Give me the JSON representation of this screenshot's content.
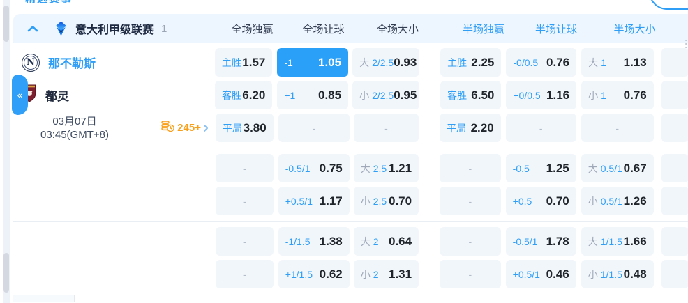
{
  "misc": {
    "dash": "-",
    "collapse_glyph": "«"
  },
  "top": {
    "clipped_tab": "精选赛事"
  },
  "league": {
    "title": "意大利甲级联赛",
    "count": "1",
    "columns": [
      {
        "label": "全场独赢",
        "scope": "full"
      },
      {
        "label": "全场让球",
        "scope": "full"
      },
      {
        "label": "全场大小",
        "scope": "full"
      },
      {
        "label": "半场独赢",
        "scope": "half"
      },
      {
        "label": "半场让球",
        "scope": "half"
      },
      {
        "label": "半场大小",
        "scope": "half"
      }
    ]
  },
  "match": {
    "home": "那不勒斯",
    "home_badge_letter": "N",
    "away": "都灵",
    "date": "03月07日",
    "time": "03:45(GMT+8)",
    "markets_count": "245+"
  },
  "colors": {
    "accent_blue": "#2f9ef6",
    "selected_bg": "#2aa0f8",
    "orange": "#f9a01b"
  },
  "odds": {
    "g1": {
      "rows": [
        {
          "cells": [
            {
              "label": "主胜",
              "value": "1.57"
            },
            {
              "line": "-1",
              "value": "1.05",
              "selected": true
            },
            {
              "prefix": "大",
              "line": "2/2.5",
              "value": "0.93"
            },
            {
              "label": "主胜",
              "value": "2.25"
            },
            {
              "line": "-0/0.5",
              "value": "0.76"
            },
            {
              "prefix": "大",
              "line": "1",
              "value": "1.13"
            }
          ]
        },
        {
          "cells": [
            {
              "label": "客胜",
              "value": "6.20"
            },
            {
              "line": "+1",
              "value": "0.85"
            },
            {
              "prefix": "小",
              "line": "2/2.5",
              "value": "0.95"
            },
            {
              "label": "客胜",
              "value": "6.50"
            },
            {
              "line": "+0/0.5",
              "value": "1.16"
            },
            {
              "prefix": "小",
              "line": "1",
              "value": "0.76"
            }
          ]
        },
        {
          "cells": [
            {
              "label": "平局",
              "value": "3.80"
            },
            {
              "empty": true
            },
            {
              "empty": true
            },
            {
              "label": "平局",
              "value": "2.20"
            },
            {
              "empty": true
            },
            {
              "empty": true
            }
          ]
        }
      ]
    },
    "g2": {
      "rows": [
        {
          "cells": [
            {
              "empty": true
            },
            {
              "line": "-0.5/1",
              "value": "0.75"
            },
            {
              "prefix": "大",
              "line": "2.5",
              "value": "1.21"
            },
            {
              "empty": true
            },
            {
              "line": "-0.5",
              "value": "1.25"
            },
            {
              "prefix": "大",
              "line": "0.5/1",
              "value": "0.67"
            }
          ]
        },
        {
          "cells": [
            {
              "empty": true
            },
            {
              "line": "+0.5/1",
              "value": "1.17"
            },
            {
              "prefix": "小",
              "line": "2.5",
              "value": "0.70"
            },
            {
              "empty": true
            },
            {
              "line": "+0.5",
              "value": "0.70"
            },
            {
              "prefix": "小",
              "line": "0.5/1",
              "value": "1.26"
            }
          ]
        }
      ]
    },
    "g3": {
      "rows": [
        {
          "cells": [
            {
              "empty": true
            },
            {
              "line": "-1/1.5",
              "value": "1.38"
            },
            {
              "prefix": "大",
              "line": "2",
              "value": "0.64"
            },
            {
              "empty": true
            },
            {
              "line": "-0.5/1",
              "value": "1.78"
            },
            {
              "prefix": "大",
              "line": "1/1.5",
              "value": "1.66"
            }
          ]
        },
        {
          "cells": [
            {
              "empty": true
            },
            {
              "line": "+1/1.5",
              "value": "0.62"
            },
            {
              "prefix": "小",
              "line": "2",
              "value": "1.31"
            },
            {
              "empty": true
            },
            {
              "line": "+0.5/1",
              "value": "0.46"
            },
            {
              "prefix": "小",
              "line": "1/1.5",
              "value": "0.48"
            }
          ]
        }
      ]
    }
  }
}
